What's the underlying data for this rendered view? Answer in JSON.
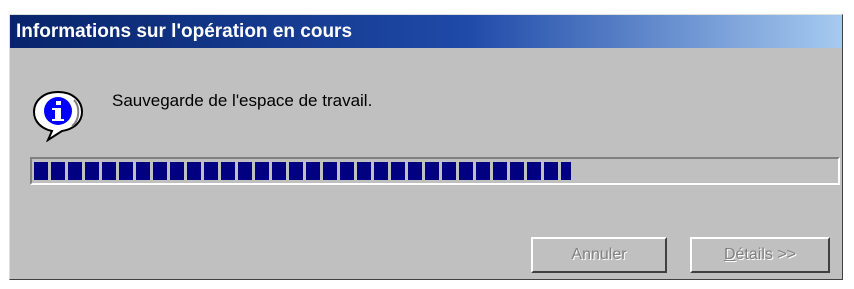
{
  "window": {
    "title": "Informations sur l'opération en cours"
  },
  "message": {
    "icon": "info-icon",
    "text": "Sauvegarde de l'espace de travail."
  },
  "progress": {
    "value_percent": 67
  },
  "buttons": {
    "cancel_label": "Annuler",
    "details_label_first": "D",
    "details_label_rest": "étails >>",
    "disabled": true
  },
  "colors": {
    "title_bar_start": "#08246b",
    "title_bar_end": "#a6caf0",
    "dialog_background": "#c0c0c0",
    "progress_fill": "#000080",
    "disabled_text": "#808080"
  }
}
